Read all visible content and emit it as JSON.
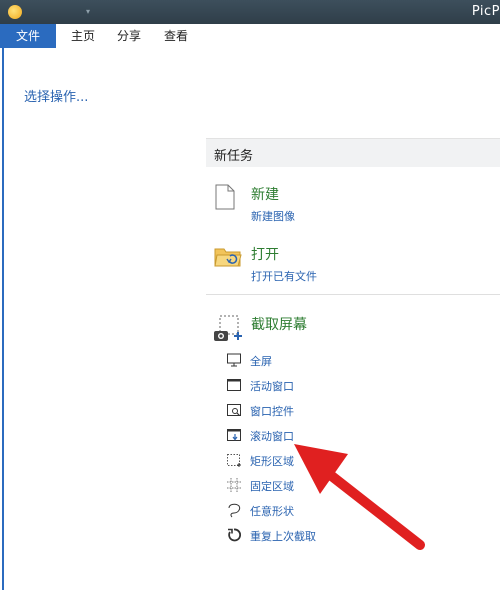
{
  "titlebar": {
    "title": "PicP"
  },
  "menu": {
    "file": "文件",
    "home": "主页",
    "share": "分享",
    "view": "查看"
  },
  "left": {
    "prompt": "选择操作..."
  },
  "panel": {
    "title": "新任务",
    "new": {
      "title": "新建",
      "subtitle": "新建图像"
    },
    "open": {
      "title": "打开",
      "subtitle": "打开已有文件"
    },
    "capture": {
      "title": "截取屏幕",
      "items": [
        {
          "label": "全屏",
          "icon": "monitor-icon"
        },
        {
          "label": "活动窗口",
          "icon": "window-icon"
        },
        {
          "label": "窗口控件",
          "icon": "window-control-icon"
        },
        {
          "label": "滚动窗口",
          "icon": "scroll-window-icon"
        },
        {
          "label": "矩形区域",
          "icon": "rectangle-region-icon"
        },
        {
          "label": "固定区域",
          "icon": "fixed-region-icon"
        },
        {
          "label": "任意形状",
          "icon": "freeform-icon"
        },
        {
          "label": "重复上次截取",
          "icon": "repeat-icon"
        }
      ]
    }
  },
  "colors": {
    "accent": "#2b6bbf",
    "green": "#2e7d32",
    "arrow": "#e02020"
  }
}
